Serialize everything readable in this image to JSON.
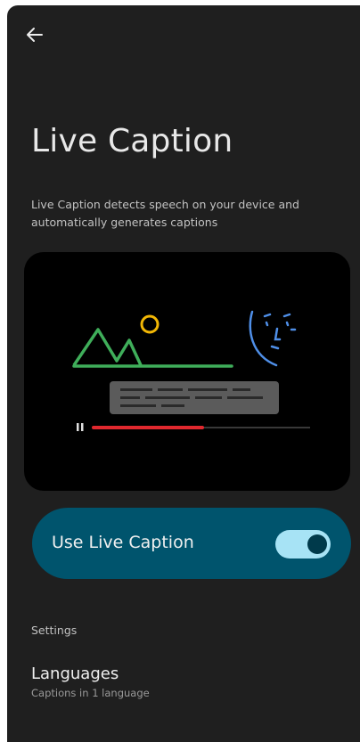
{
  "app_bar": {
    "back_icon": "arrow-back-icon"
  },
  "page": {
    "title": "Live Caption",
    "description": "Live Caption detects speech on your device and automatically generates captions"
  },
  "illustration": {
    "icons": [
      "mountains-icon",
      "sun-icon",
      "face-icon",
      "caption-box-icon",
      "pause-icon",
      "progress-bar"
    ],
    "playback_progress": 0.5
  },
  "toggle": {
    "label": "Use Live Caption",
    "state": "on",
    "card_color": "#00546d",
    "track_color": "#a7e3f5",
    "thumb_color": "#003a4b"
  },
  "settings": {
    "header": "Settings",
    "items": [
      {
        "title": "Languages",
        "subtitle": "Captions in 1 language"
      }
    ]
  },
  "colors": {
    "background": "#1f1f1f",
    "mountain_green": "#3fae5a",
    "sun_yellow": "#f2b705",
    "face_blue": "#4f8fe8",
    "progress_red": "#e0282e"
  }
}
